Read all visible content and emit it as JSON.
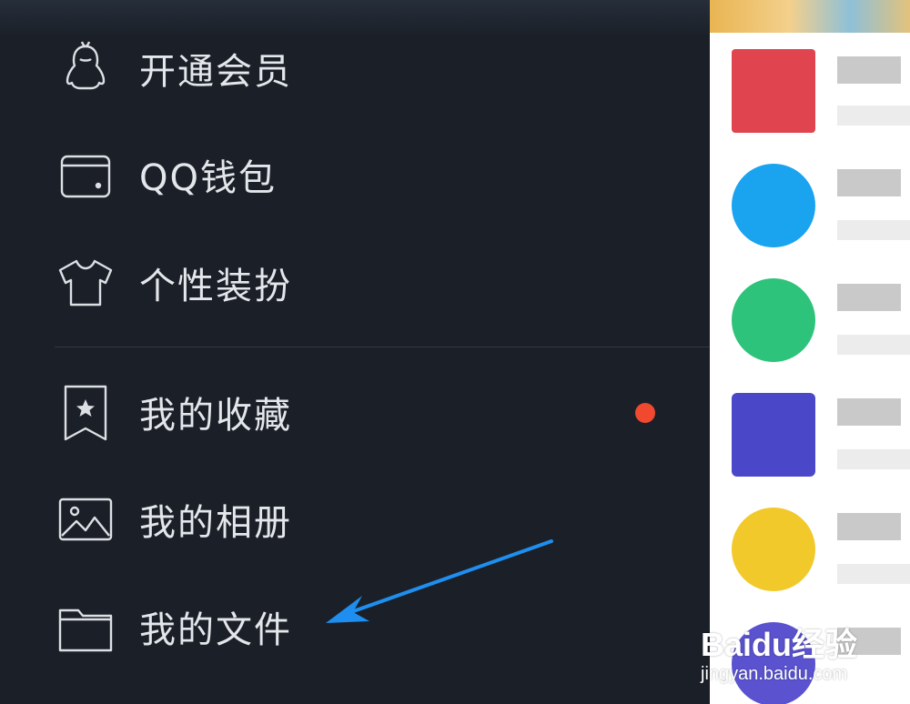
{
  "drawer": {
    "items": [
      {
        "label": "开通会员",
        "icon": "penguin-icon"
      },
      {
        "label": "QQ钱包",
        "icon": "wallet-icon"
      },
      {
        "label": "个性装扮",
        "icon": "tshirt-icon"
      },
      {
        "label": "我的收藏",
        "icon": "bookmark-star-icon",
        "has_badge": true
      },
      {
        "label": "我的相册",
        "icon": "image-icon"
      },
      {
        "label": "我的文件",
        "icon": "folder-icon"
      }
    ],
    "badge_color": "#f0492f",
    "arrow_color": "#1e8ff0",
    "arrow_target": "我的文件"
  },
  "list_pane": {
    "avatar_colors": [
      "#e0444f",
      "#1aa3ef",
      "#2ec37a",
      "#4a47c9",
      "#f2c92a",
      "#5a52cf"
    ]
  },
  "watermark": {
    "main": "Baidu经验",
    "sub": "jingyan.baidu.com"
  },
  "colors": {
    "drawer_bg": "#1b2028",
    "label_text": "#e3e6ea",
    "icon_stroke": "#dcdfe3"
  }
}
